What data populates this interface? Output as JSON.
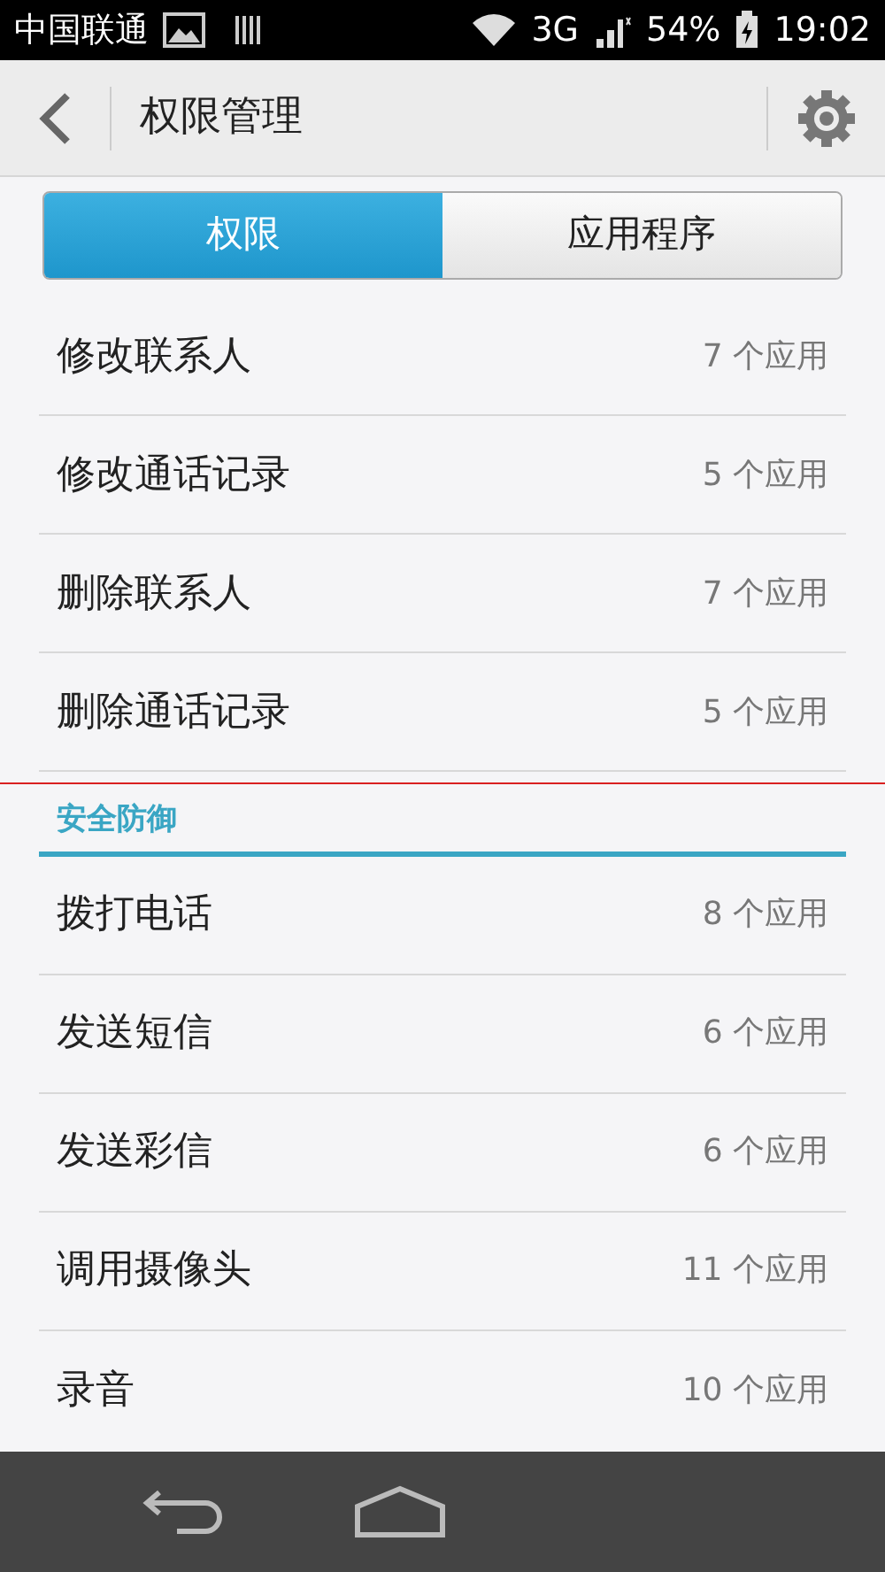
{
  "status_bar": {
    "carrier": "中国联通",
    "network": "3G",
    "battery": "54%",
    "time": "19:02"
  },
  "header": {
    "title": "权限管理"
  },
  "tabs": [
    {
      "label": "权限",
      "selected": true
    },
    {
      "label": "应用程序",
      "selected": false
    }
  ],
  "sections": [
    {
      "items": [
        {
          "name": "修改联系人",
          "count": "7 个应用"
        },
        {
          "name": "修改通话记录",
          "count": "5 个应用"
        },
        {
          "name": "删除联系人",
          "count": "7 个应用"
        },
        {
          "name": "删除通话记录",
          "count": "5 个应用"
        }
      ]
    },
    {
      "title": "安全防御",
      "items": [
        {
          "name": "拨打电话",
          "count": "8 个应用"
        },
        {
          "name": "发送短信",
          "count": "6 个应用"
        },
        {
          "name": "发送彩信",
          "count": "6 个应用"
        },
        {
          "name": "调用摄像头",
          "count": "11 个应用"
        },
        {
          "name": "录音",
          "count": "10 个应用"
        }
      ]
    }
  ]
}
